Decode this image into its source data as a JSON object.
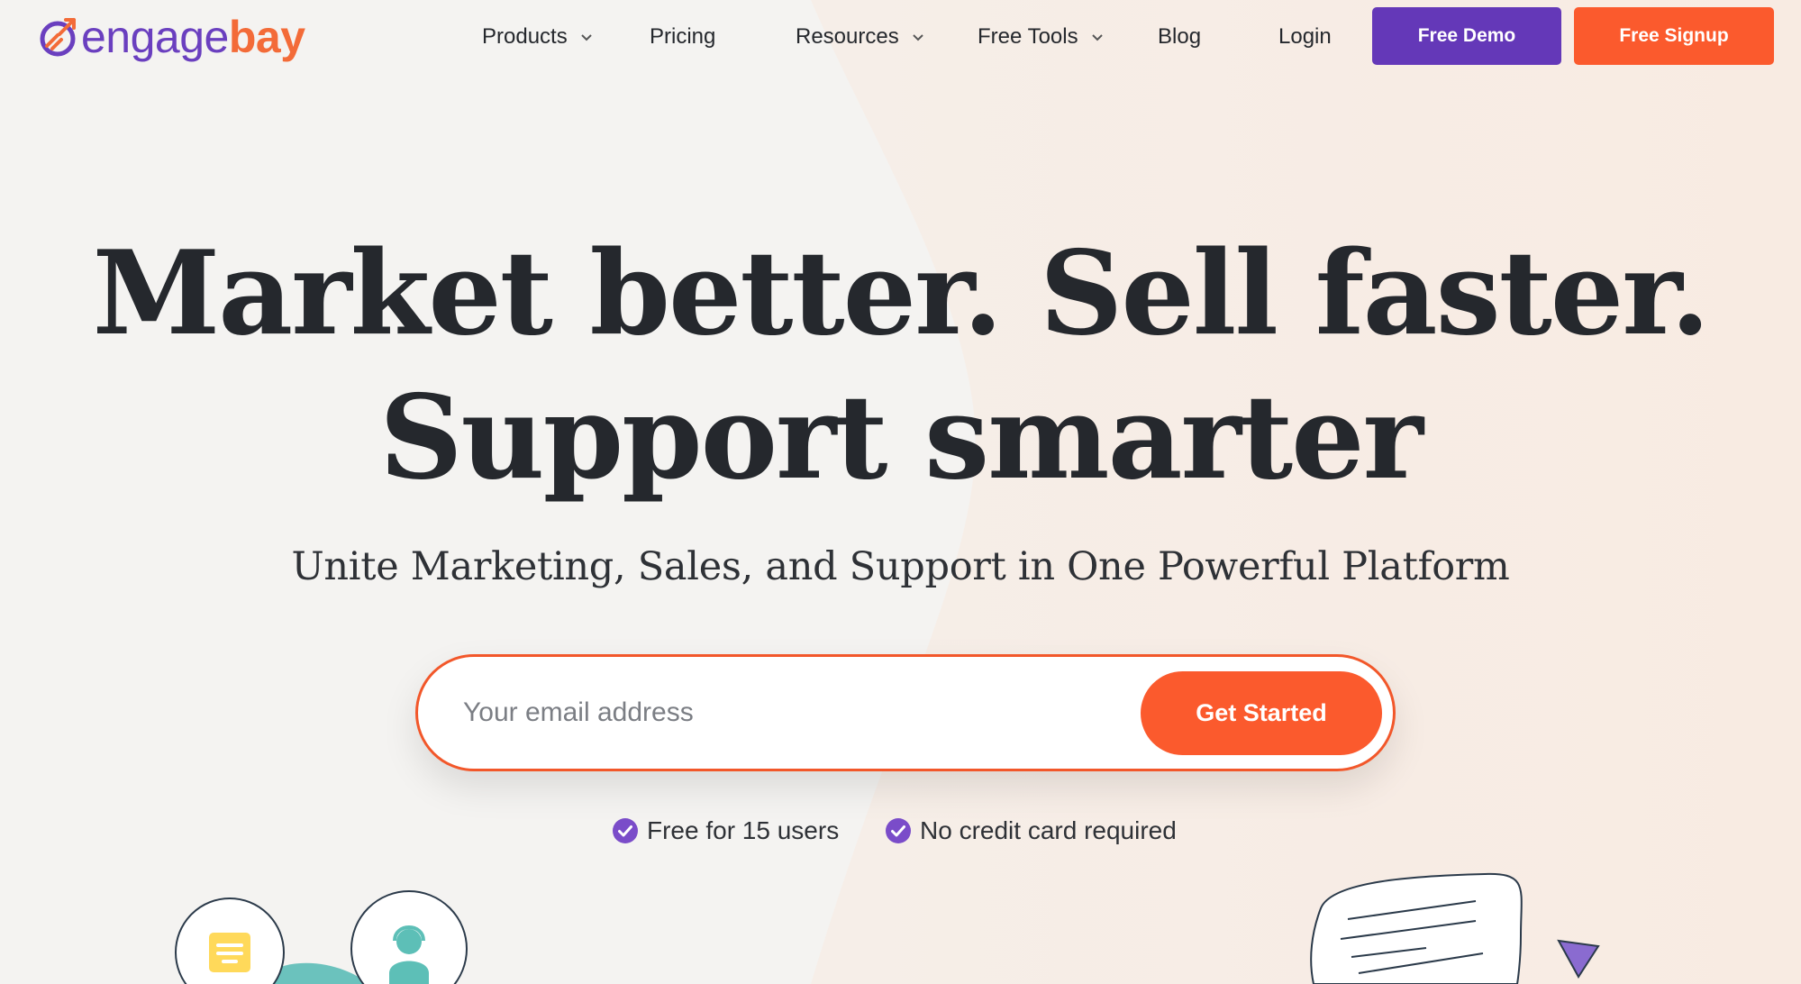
{
  "brand": {
    "logo_part1": "engage",
    "logo_part2": "bay",
    "colors": {
      "purple": "#6438b8",
      "orange": "#fb5a2d",
      "text": "#25282d"
    }
  },
  "nav": {
    "items": [
      {
        "label": "Products",
        "has_dropdown": true
      },
      {
        "label": "Pricing",
        "has_dropdown": false
      },
      {
        "label": "Resources",
        "has_dropdown": true
      },
      {
        "label": "Free Tools",
        "has_dropdown": true
      },
      {
        "label": "Blog",
        "has_dropdown": false
      },
      {
        "label": "Login",
        "has_dropdown": false
      }
    ],
    "demo_label": "Free Demo",
    "signup_label": "Free Signup"
  },
  "hero": {
    "headline_line1": "Market better. Sell faster.",
    "headline_line2": "Support smarter",
    "subheadline": "Unite Marketing, Sales, and Support in One Powerful Platform",
    "email_placeholder": "Your email address",
    "cta_label": "Get Started",
    "perks": [
      "Free for 15 users",
      "No credit card required"
    ]
  },
  "icons": {
    "check": "check-circle-icon",
    "chevron": "chevron-down-icon",
    "document": "document-icon",
    "support_agent": "support-agent-icon",
    "speech_bubble": "speech-bubble-icon",
    "triangle": "triangle-shape-icon"
  }
}
